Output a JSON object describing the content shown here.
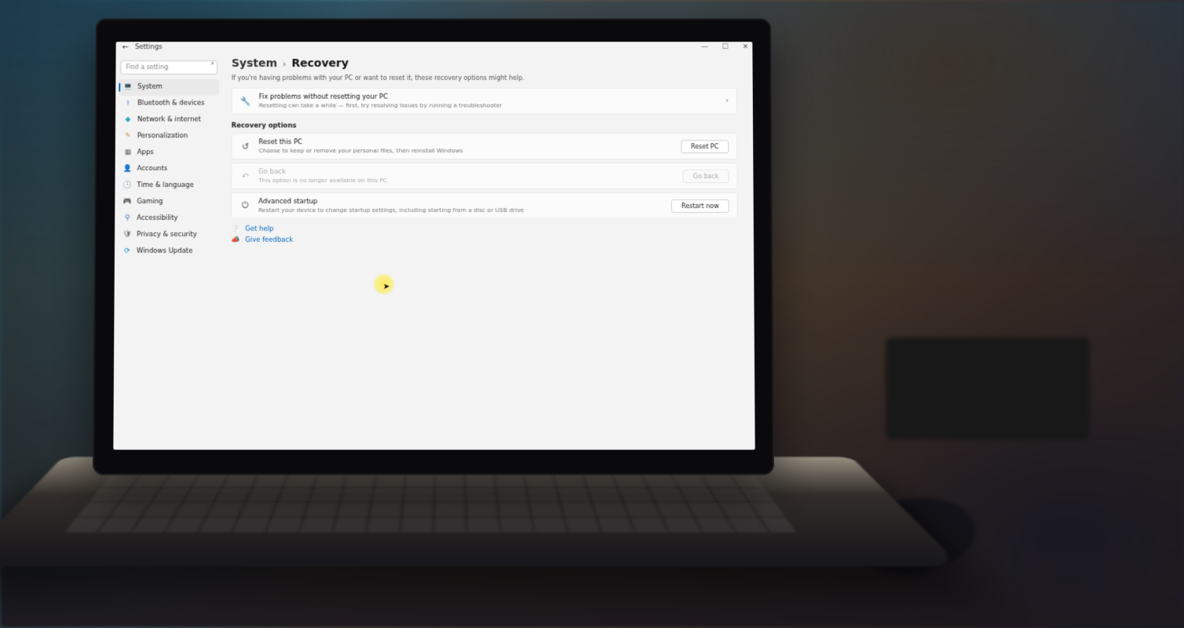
{
  "titlebar": {
    "app": "Settings"
  },
  "search": {
    "placeholder": "Find a setting"
  },
  "nav": [
    {
      "label": "System",
      "icon": "💻",
      "color": "#3a77c8",
      "active": true
    },
    {
      "label": "Bluetooth & devices",
      "icon": "ᚼ",
      "color": "#2f74d0"
    },
    {
      "label": "Network & internet",
      "icon": "◆",
      "color": "#2aa6c9"
    },
    {
      "label": "Personalization",
      "icon": "✎",
      "color": "#d08b3e"
    },
    {
      "label": "Apps",
      "icon": "▦",
      "color": "#6c6c6c"
    },
    {
      "label": "Accounts",
      "icon": "👤",
      "color": "#3aa06a"
    },
    {
      "label": "Time & language",
      "icon": "🕓",
      "color": "#6c6c6c"
    },
    {
      "label": "Gaming",
      "icon": "🎮",
      "color": "#6c6c6c"
    },
    {
      "label": "Accessibility",
      "icon": "⚲",
      "color": "#3a6fc0"
    },
    {
      "label": "Privacy & security",
      "icon": "🛡",
      "color": "#6c6c6c"
    },
    {
      "label": "Windows Update",
      "icon": "⟳",
      "color": "#1e90d4"
    }
  ],
  "breadcrumb": {
    "parent": "System",
    "current": "Recovery"
  },
  "intro": "If you're having problems with your PC or want to reset it, these recovery options might help.",
  "fix_card": {
    "title": "Fix problems without resetting your PC",
    "sub": "Resetting can take a while — first, try resolving issues by running a troubleshooter"
  },
  "recovery_header": "Recovery options",
  "rows": [
    {
      "key": "reset",
      "title": "Reset this PC",
      "sub": "Choose to keep or remove your personal files, then reinstall Windows",
      "button": "Reset PC",
      "disabled": false,
      "icon": "↺"
    },
    {
      "key": "goback",
      "title": "Go back",
      "sub": "This option is no longer available on this PC",
      "button": "Go back",
      "disabled": true,
      "icon": "↶"
    },
    {
      "key": "advanced",
      "title": "Advanced startup",
      "sub": "Restart your device to change startup settings, including starting from a disc or USB drive",
      "button": "Restart now",
      "disabled": false,
      "icon": "⏻"
    }
  ],
  "links": {
    "help": "Get help",
    "feedback": "Give feedback"
  }
}
